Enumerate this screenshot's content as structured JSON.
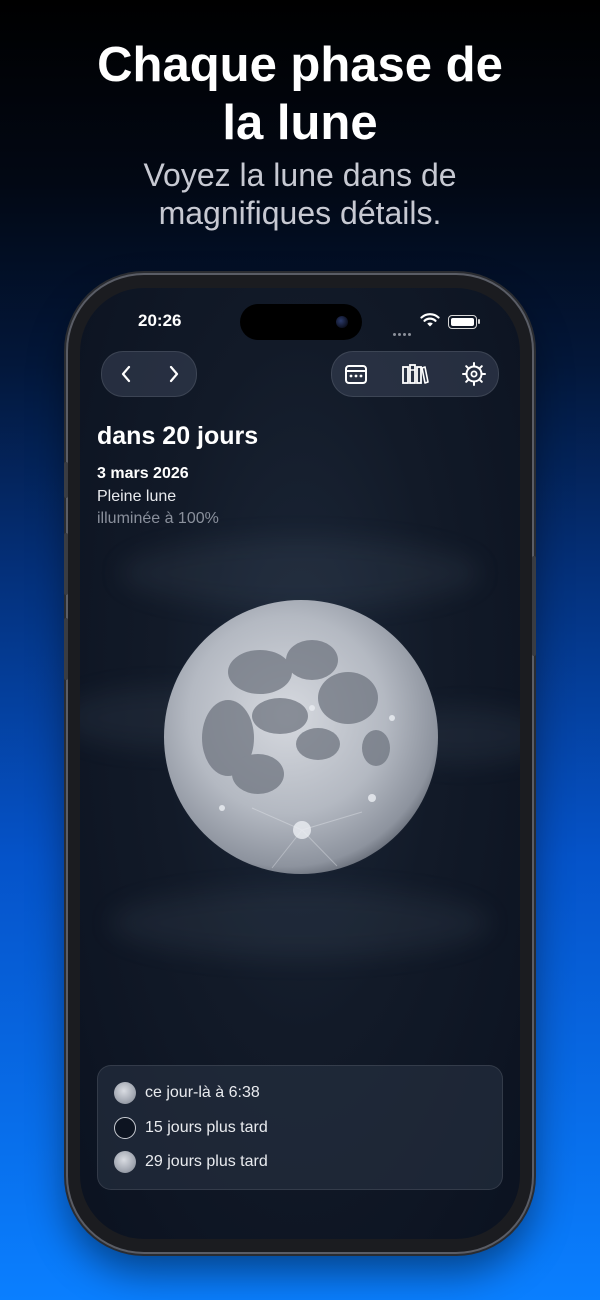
{
  "promo": {
    "title_line1": "Chaque phase de",
    "title_line2": "la lune",
    "subtitle_line1": "Voyez la lune dans de",
    "subtitle_line2": "magnifiques détails."
  },
  "status_bar": {
    "time": "20:26"
  },
  "toolbar": {
    "icons": [
      "chevron-left-icon",
      "chevron-right-icon",
      "calendar-icon",
      "library-icon",
      "settings-gear-icon"
    ]
  },
  "phase": {
    "countdown": "dans 20 jours",
    "date": "3 mars 2026",
    "name": "Pleine lune",
    "illumination": "illuminée à 100%"
  },
  "upcoming": [
    {
      "label": "ce jour-là à 6:38",
      "icon": "full-moon-icon"
    },
    {
      "label": "15 jours plus tard",
      "icon": "new-moon-icon"
    },
    {
      "label": "29 jours plus tard",
      "icon": "full-moon-icon"
    }
  ],
  "colors": {
    "background_top": "#000000",
    "background_bottom": "#0a7fff",
    "screen_bg": "#121a28",
    "accent_text": "#ffffff"
  }
}
